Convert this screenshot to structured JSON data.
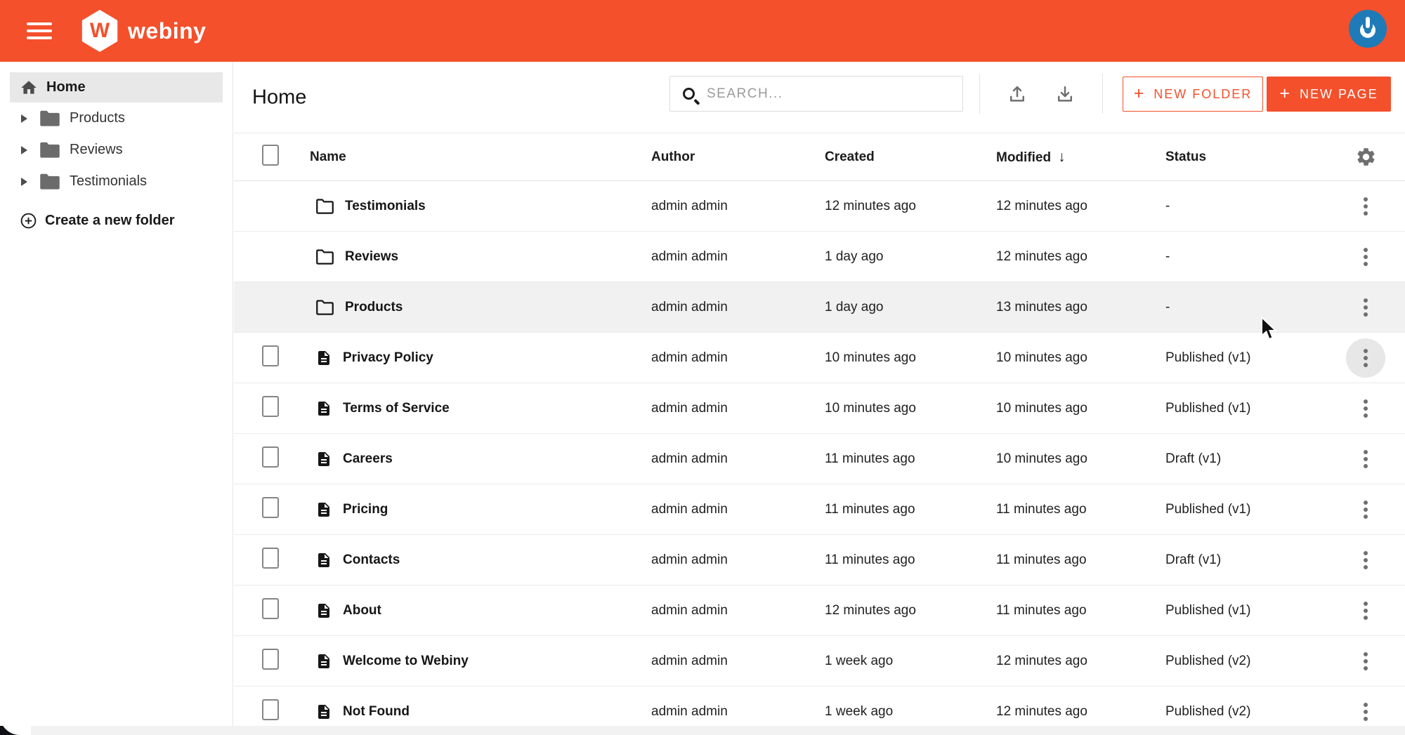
{
  "topbar": {
    "brand_text": "webiny",
    "brand_letter": "W",
    "hamburger_icon": "menu-icon",
    "avatar_icon": "gravatar-power-icon"
  },
  "sidebar": {
    "items": [
      {
        "label": "Home",
        "icon": "home-icon",
        "selected": true
      },
      {
        "label": "Products",
        "icon": "folder-icon"
      },
      {
        "label": "Reviews",
        "icon": "folder-icon"
      },
      {
        "label": "Testimonials",
        "icon": "folder-icon"
      }
    ],
    "create_folder_label": "Create a new folder"
  },
  "header": {
    "title": "Home",
    "search_placeholder": "SEARCH...",
    "search_value": "",
    "upload_icon": "upload-icon",
    "download_icon": "download-icon",
    "plus_glyph": "+",
    "new_folder_label": "NEW FOLDER",
    "new_page_label": "NEW PAGE"
  },
  "table": {
    "columns": [
      "Name",
      "Author",
      "Created",
      "Modified",
      "Status"
    ],
    "sorted_column": "Modified",
    "sort_indicator": "↓",
    "settings_icon": "gear-icon",
    "rows": [
      {
        "type": "folder",
        "name": "Testimonials",
        "author": "admin admin",
        "created": "12 minutes ago",
        "modified": "12 minutes ago",
        "status": "-"
      },
      {
        "type": "folder",
        "name": "Reviews",
        "author": "admin admin",
        "created": "1 day ago",
        "modified": "12 minutes ago",
        "status": "-"
      },
      {
        "type": "folder",
        "name": "Products",
        "author": "admin admin",
        "created": "1 day ago",
        "modified": "13 minutes ago",
        "status": "-",
        "highlighted": true
      },
      {
        "type": "page",
        "name": "Privacy Policy",
        "author": "admin admin",
        "created": "10 minutes ago",
        "modified": "10 minutes ago",
        "status": "Published (v1)",
        "menu_hover": true
      },
      {
        "type": "page",
        "name": "Terms of Service",
        "author": "admin admin",
        "created": "10 minutes ago",
        "modified": "10 minutes ago",
        "status": "Published (v1)"
      },
      {
        "type": "page",
        "name": "Careers",
        "author": "admin admin",
        "created": "11 minutes ago",
        "modified": "10 minutes ago",
        "status": "Draft (v1)"
      },
      {
        "type": "page",
        "name": "Pricing",
        "author": "admin admin",
        "created": "11 minutes ago",
        "modified": "11 minutes ago",
        "status": "Published (v1)"
      },
      {
        "type": "page",
        "name": "Contacts",
        "author": "admin admin",
        "created": "11 minutes ago",
        "modified": "11 minutes ago",
        "status": "Draft (v1)"
      },
      {
        "type": "page",
        "name": "About",
        "author": "admin admin",
        "created": "12 minutes ago",
        "modified": "11 minutes ago",
        "status": "Published (v1)"
      },
      {
        "type": "page",
        "name": "Welcome to Webiny",
        "author": "admin admin",
        "created": "1 week ago",
        "modified": "12 minutes ago",
        "status": "Published (v2)"
      },
      {
        "type": "page",
        "name": "Not Found",
        "author": "admin admin",
        "created": "1 week ago",
        "modified": "12 minutes ago",
        "status": "Published (v2)"
      }
    ]
  },
  "colors": {
    "primary_orange": "#f4502c",
    "avatar_blue": "#1e7bb8",
    "selected_sidebar_bg": "#e8e8e8",
    "row_highlight_bg": "#f1f1f1",
    "bottom_strip": "#f2f2f2",
    "dark_corner": "#0f1117"
  }
}
